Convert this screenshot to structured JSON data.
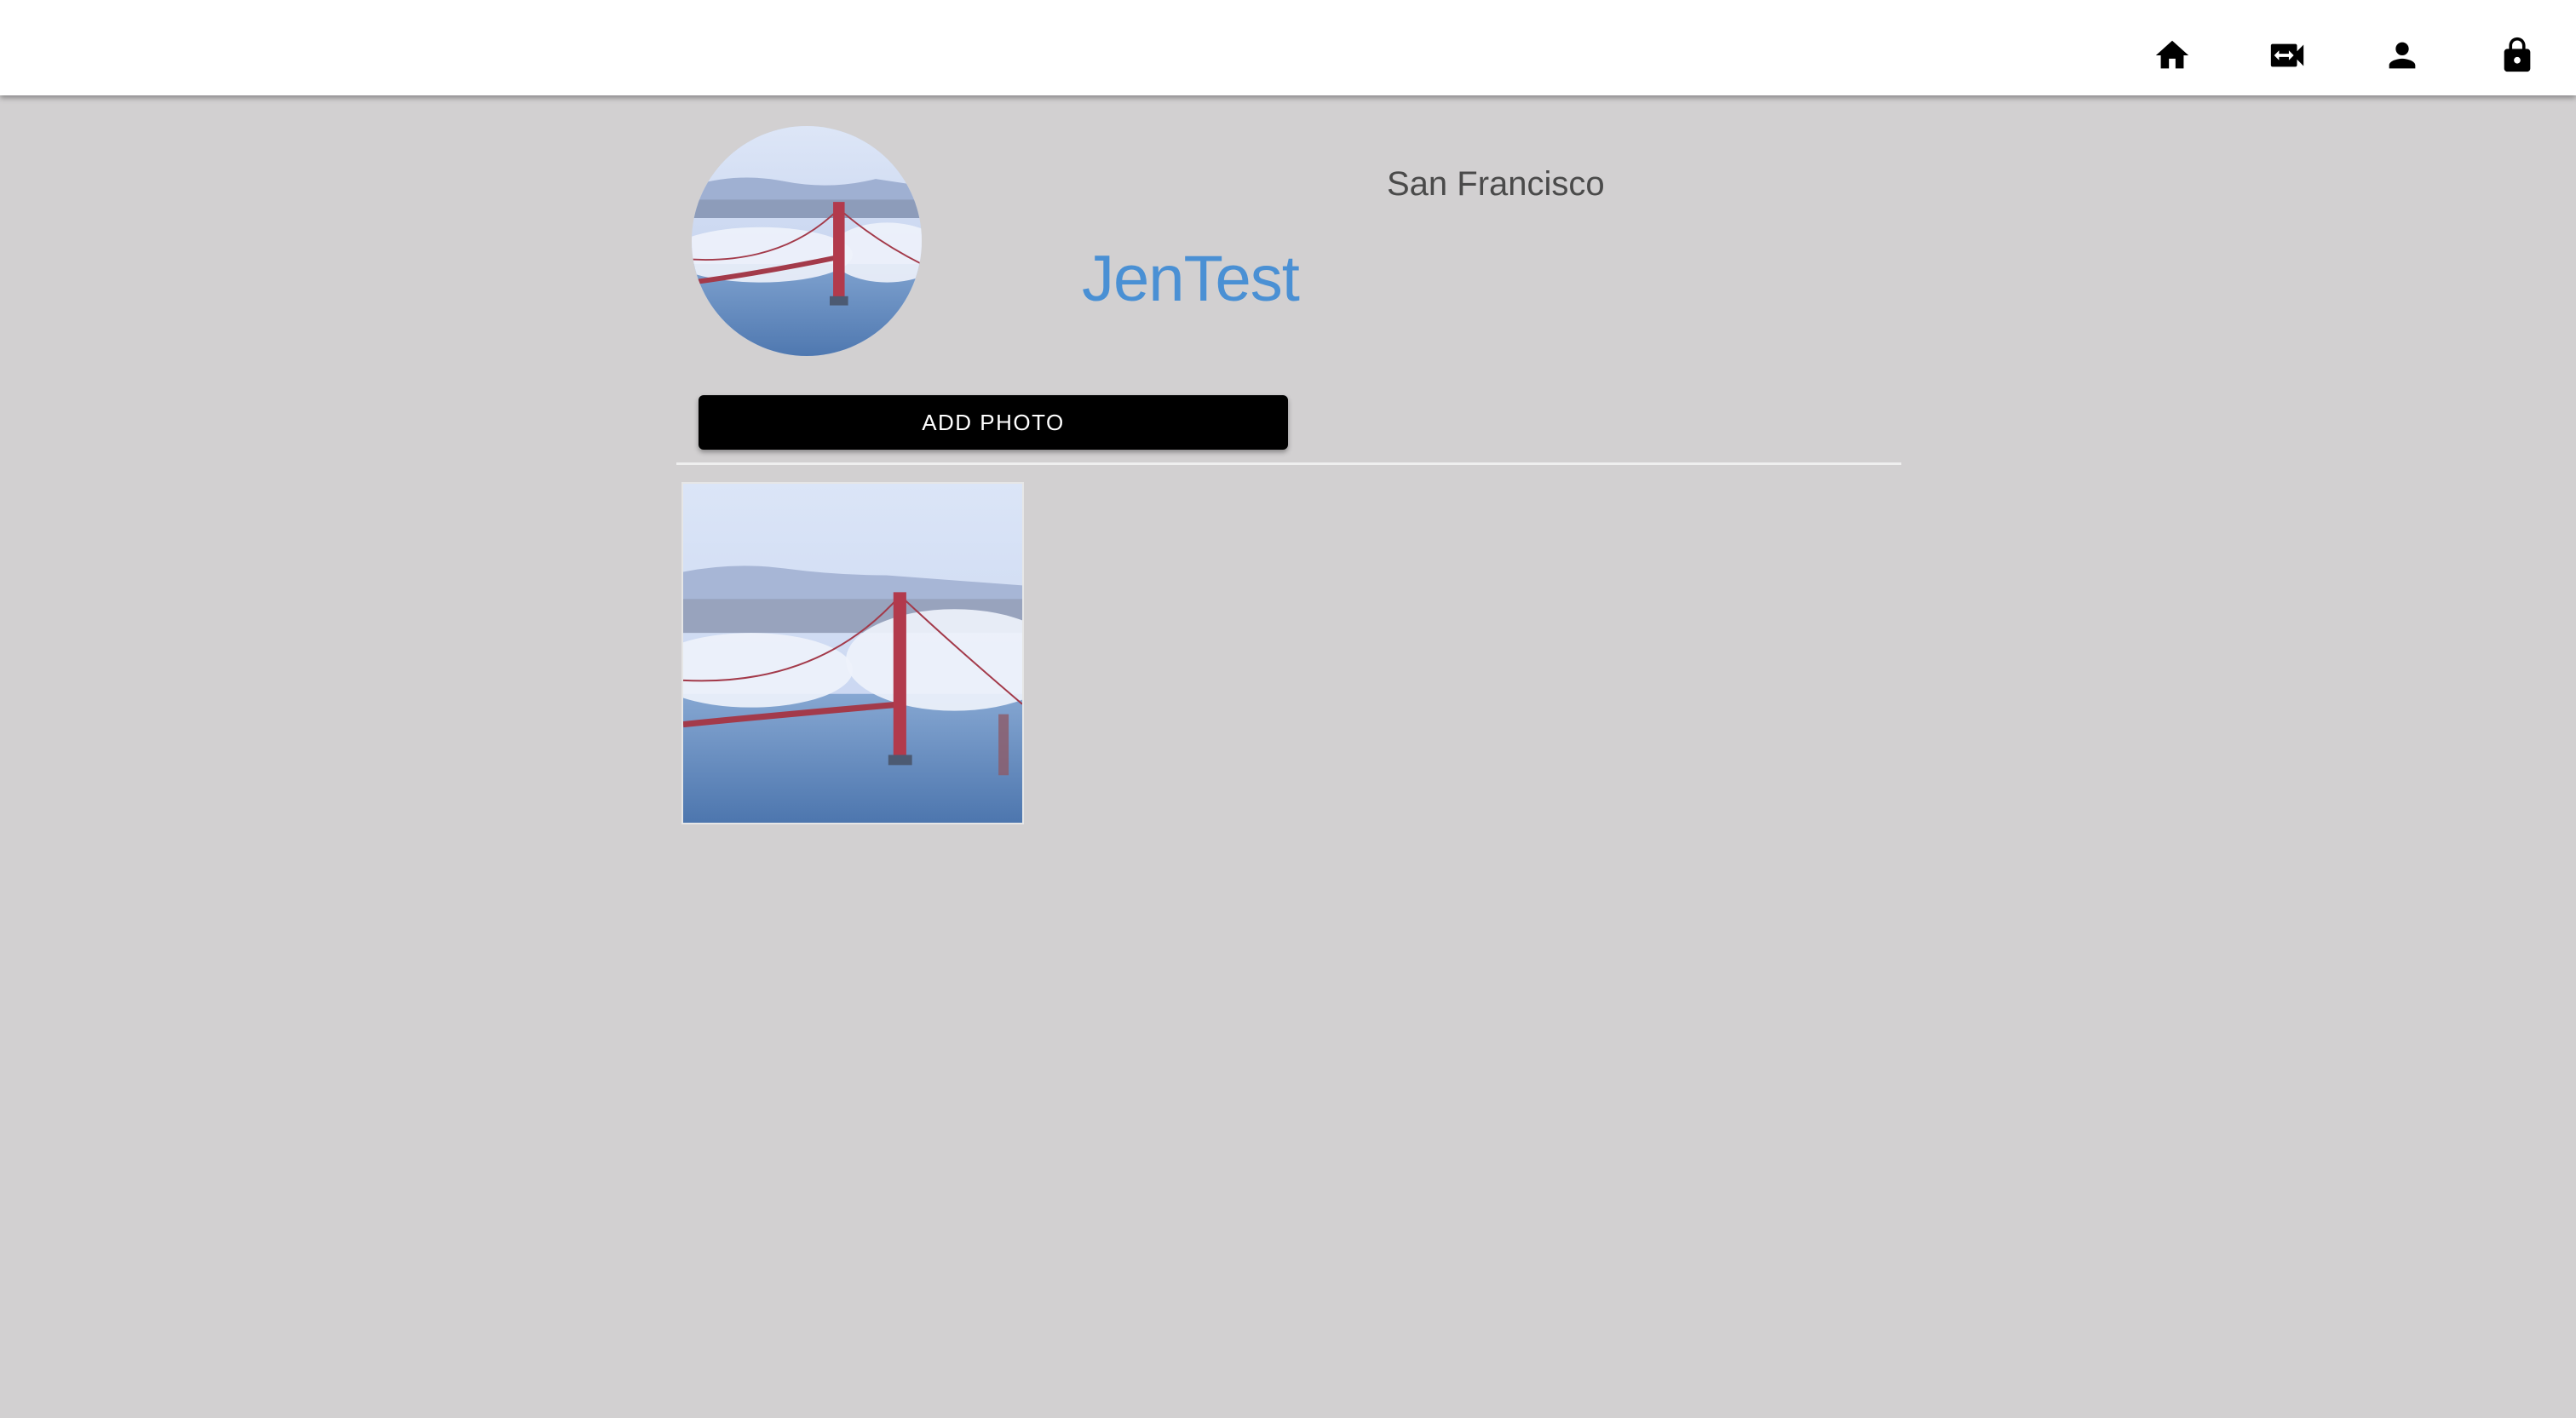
{
  "nav": {
    "items": [
      {
        "name": "nav-home",
        "icon": "home-icon"
      },
      {
        "name": "nav-video",
        "icon": "video-switch-icon"
      },
      {
        "name": "nav-profile",
        "icon": "person-icon"
      },
      {
        "name": "nav-logout",
        "icon": "lock-icon"
      }
    ]
  },
  "profile": {
    "location": "San Francisco",
    "username": "JenTest",
    "avatar_image": "golden-gate-bridge-photo"
  },
  "actions": {
    "add_photo_label": "ADD PHOTO"
  },
  "gallery": {
    "photos": [
      {
        "subject": "golden-gate-bridge-photo"
      }
    ]
  },
  "colors": {
    "background": "#d2d0d1",
    "topbar": "#ffffff",
    "username": "#4a90d4",
    "location": "#4a4a4a",
    "button_bg": "#000000",
    "button_text": "#ffffff"
  }
}
